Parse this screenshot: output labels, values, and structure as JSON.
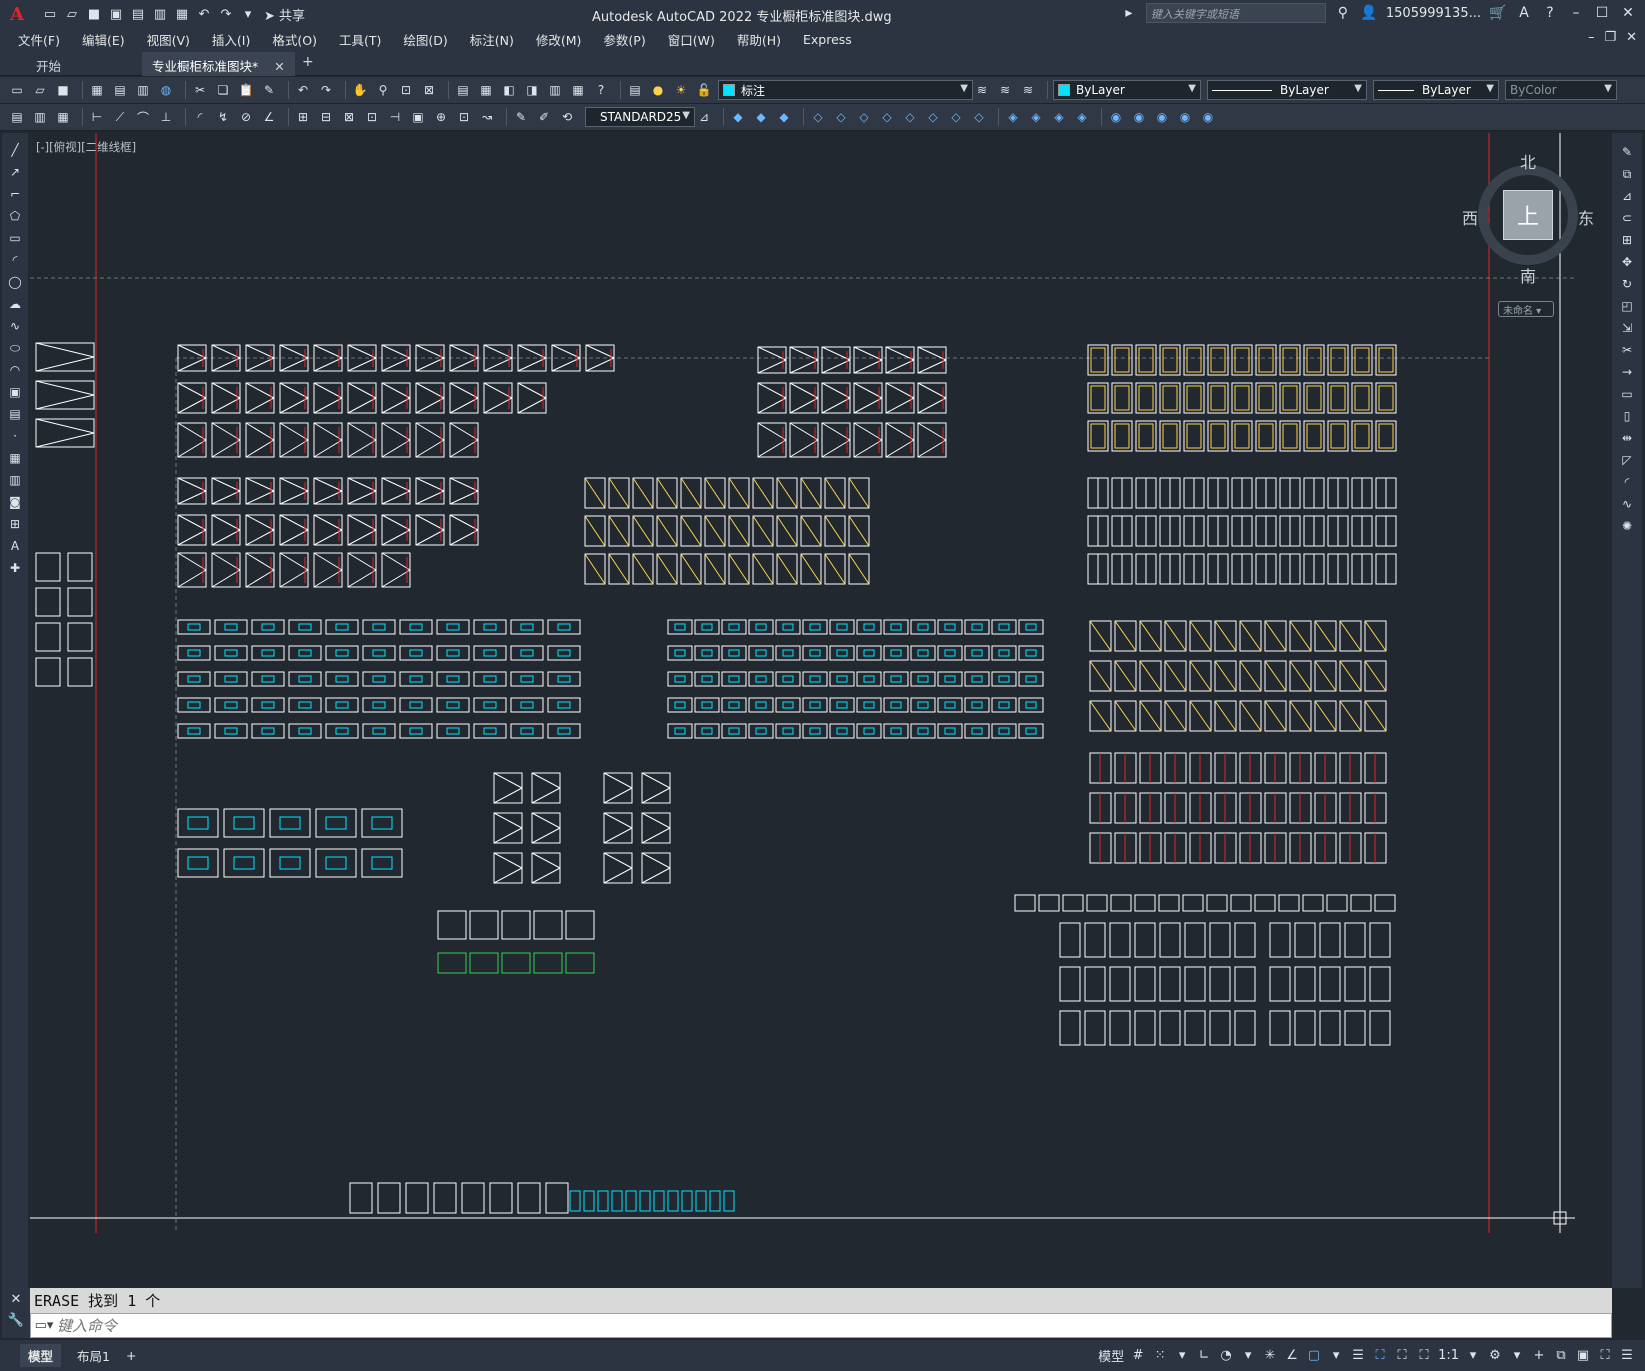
{
  "window": {
    "app_logo": "A",
    "title": "Autodesk AutoCAD 2022    专业橱柜标准图块.dwg",
    "search_placeholder": "键入关键字或短语",
    "user": "1505999135...",
    "share_label": "共享"
  },
  "menu": [
    "文件(F)",
    "编辑(E)",
    "视图(V)",
    "插入(I)",
    "格式(O)",
    "工具(T)",
    "绘图(D)",
    "标注(N)",
    "修改(M)",
    "参数(P)",
    "窗口(W)",
    "帮助(H)",
    "Express"
  ],
  "tabs": {
    "start": "开始",
    "active": "专业橱柜标准图块*",
    "close": "✕",
    "plus": "+"
  },
  "toolbar": {
    "layer_name": "标注",
    "color": "ByLayer",
    "linetype": "ByLayer",
    "lineweight": "ByLayer",
    "plotstyle": "ByColor",
    "dimstyle": "STANDARD25"
  },
  "viewport": {
    "label": "[-][俯视][二维线框]",
    "cube_top": "上",
    "north": "北",
    "south": "南",
    "east": "东",
    "west": "西",
    "wcs": "未命名"
  },
  "command": {
    "history": "ERASE  找到 1 个",
    "placeholder": "键入命令"
  },
  "status": {
    "layouts": [
      "模型",
      "布局1"
    ],
    "add_layout": "+",
    "model_label": "模型",
    "scale": "1:1"
  },
  "colors": {
    "background": "#212830",
    "linework": "#ffffff",
    "accent_red": "#e0242a",
    "accent_cyan": "#00e5ff",
    "accent_yellow": "#ffd24d",
    "accent_green": "#34d058"
  }
}
